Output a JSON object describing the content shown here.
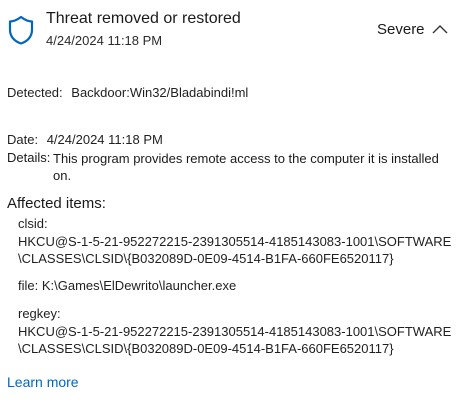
{
  "header": {
    "title": "Threat removed or restored",
    "timestamp": "4/24/2024 11:18 PM",
    "severity": "Severe",
    "accent_color": "#0067c0"
  },
  "detected": {
    "label": "Detected:",
    "value": "Backdoor:Win32/Bladabindi!ml"
  },
  "date": {
    "label": "Date:",
    "value": "4/24/2024 11:18 PM"
  },
  "details": {
    "label": "Details:",
    "value": "This program provides remote access to the computer it is installed on."
  },
  "affected": {
    "heading": "Affected items:",
    "clsid_label": "clsid:",
    "clsid_line1": "HKCU@S-1-5-21-952272215-2391305514-4185143083-1001\\SOFTWARE",
    "clsid_line2": "\\CLASSES\\CLSID\\{B032089D-0E09-4514-B1FA-660FE6520117}",
    "file_line": "file: K:\\Games\\ElDewrito\\launcher.exe",
    "regkey_label": "regkey:",
    "regkey_line1": "HKCU@S-1-5-21-952272215-2391305514-4185143083-1001\\SOFTWARE",
    "regkey_line2": "\\CLASSES\\CLSID\\{B032089D-0E09-4514-B1FA-660FE6520117}"
  },
  "footer": {
    "learn_more": "Learn more"
  },
  "icons": {
    "shield": "shield-icon",
    "chevron": "chevron-up-icon"
  }
}
